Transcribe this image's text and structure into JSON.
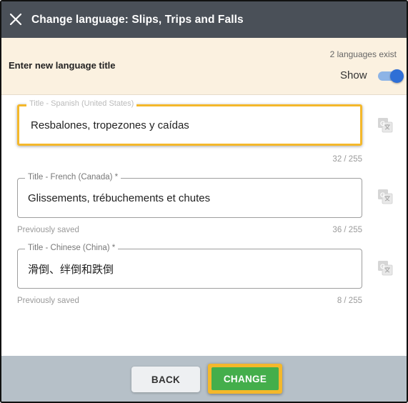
{
  "header": {
    "title": "Change language: Slips, Trips and Falls",
    "close_icon": "close-icon"
  },
  "infobar": {
    "title": "Enter new language title",
    "languages_count": "2 languages exist",
    "show_label": "Show",
    "show_enabled": true
  },
  "fields": [
    {
      "label": "Title - Spanish (United States)",
      "value": "Resbalones, tropezones y caídas",
      "helper": "",
      "counter": "32 / 255"
    },
    {
      "label": "Title - French (Canada) *",
      "value": "Glissements, trébuchements et chutes",
      "helper": "Previously saved",
      "counter": "36 / 255"
    },
    {
      "label": "Title - Chinese (China) *",
      "value": "滑倒、绊倒和跌倒",
      "helper": "Previously saved",
      "counter": "8 / 255"
    }
  ],
  "footer": {
    "back_label": "BACK",
    "change_label": "CHANGE"
  },
  "colors": {
    "header_bg": "#4a5058",
    "infobar_bg": "#fbf1e0",
    "footer_bg": "#b6c0c8",
    "highlight": "#f4b82b",
    "change_green": "#44ae4b",
    "toggle_blue": "#2f6fd6"
  }
}
